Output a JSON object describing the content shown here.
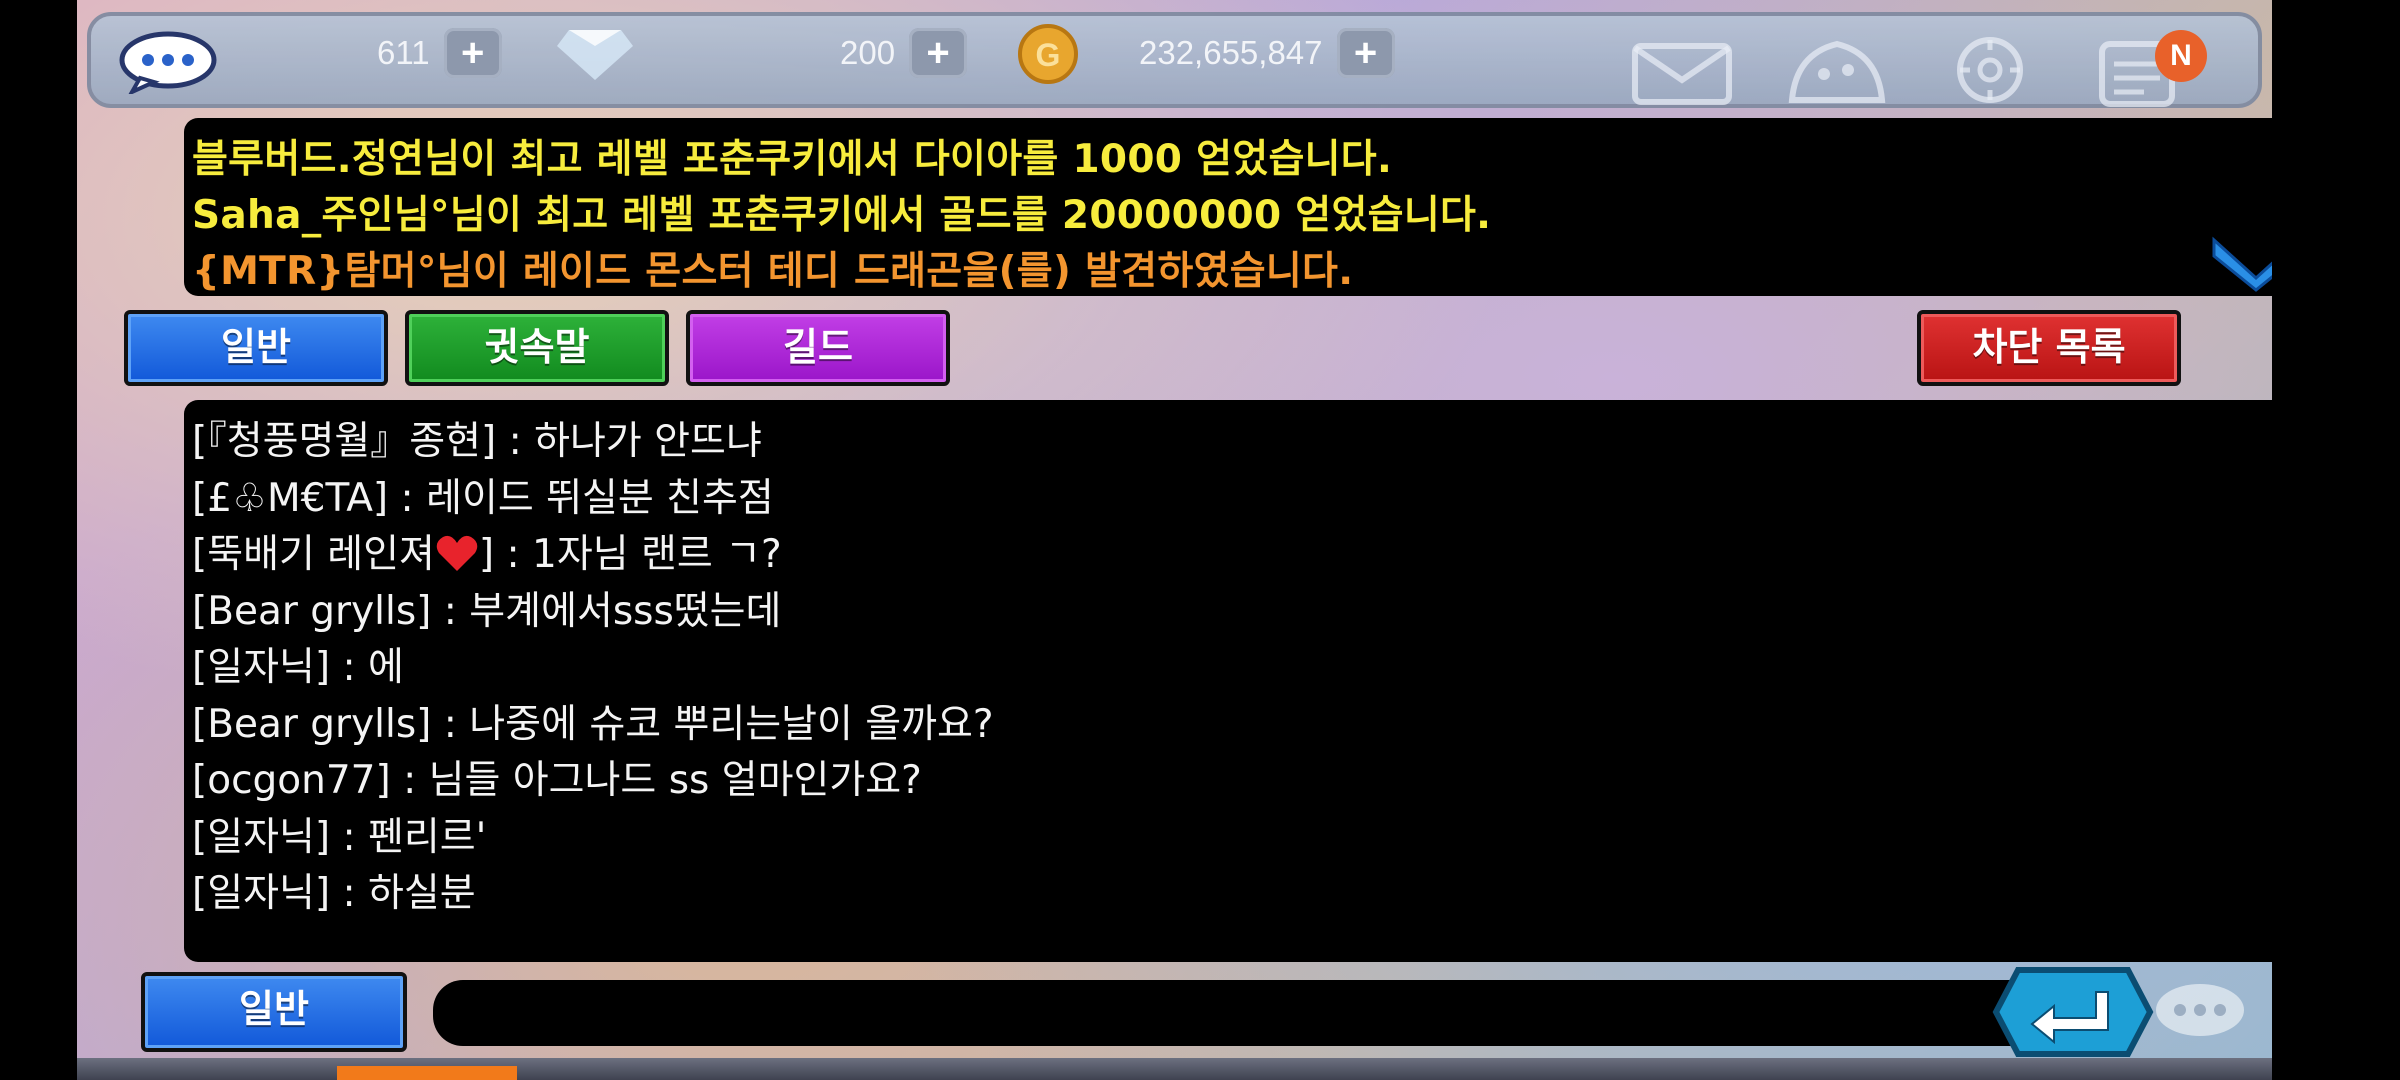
{
  "top_bar": {
    "currencies": [
      {
        "icon": "heart-energy-icon",
        "value": "611"
      },
      {
        "icon": "diamond-icon",
        "value": "200"
      },
      {
        "icon": "gold-coin-icon",
        "value": "232,655,847"
      }
    ],
    "right_icons": [
      "mail-icon",
      "cookie-kingdom-icon",
      "compass-icon",
      "quest-list-icon"
    ],
    "notification_badge": "N"
  },
  "notices": [
    {
      "text": "블루버드.정연님이 최고 레벨 포춘쿠키에서 다이아를 1000 얻었습니다.",
      "color": "#f7ec3d"
    },
    {
      "text": "Saha_주인님°님이 최고 레벨 포춘쿠키에서 골드를 20000000 얻었습니다.",
      "color": "#f7ec3d"
    },
    {
      "text": "{MTR}탐머°님이 레이드 몬스터 테디 드래곤을(를) 발견하였습니다.",
      "color": "#f3952f"
    }
  ],
  "tabs": {
    "general": "일반",
    "whisper": "귓속말",
    "guild": "길드",
    "block_list": "차단 목록"
  },
  "chat": {
    "lines": [
      "[『청풍명월』종현] : 하나가 안뜨냐",
      "[£♧M€TA] : 레이드 뛰실분 친추점",
      "[뚝배기 레인져",
      "[Bear grylls] : 부계에서sss떴는데",
      "[일자닉] : 에",
      "[Bear grylls] : 나중에 슈코 뿌리는날이 올까요?",
      "[ocgon77] : 님들 아그나드 ss 얼마인가요?",
      "[일자닉] : 펜리르'",
      "[일자닉] : 하실분"
    ],
    "heart_line_suffix": "] : 1자님 랜르 ㄱ?"
  },
  "input": {
    "channel_label": "일반",
    "value": ""
  },
  "colors": {
    "tab_blue": "#1f6fe6",
    "tab_green": "#1c9a28",
    "tab_purple": "#ad27d6",
    "tab_red": "#cc1f1f",
    "send_button": "#1d9fd6"
  }
}
